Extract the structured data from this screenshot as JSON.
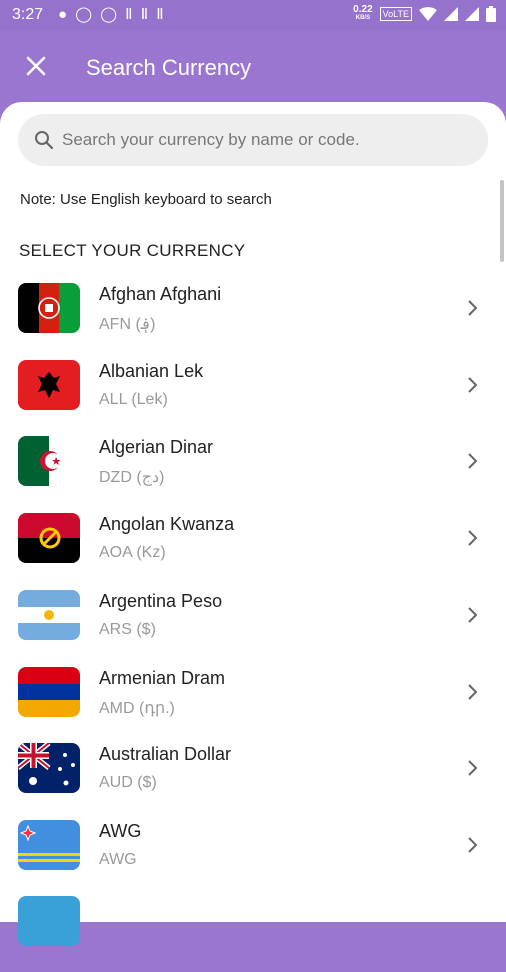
{
  "status_bar": {
    "time": "3:27",
    "speed_value": "0.22",
    "speed_unit": "KB/S",
    "network": "VoLTE"
  },
  "app_bar": {
    "title": "Search Currency"
  },
  "search": {
    "placeholder": "Search your currency by name or code."
  },
  "note": "Note: Use English keyboard to search",
  "section_title": "SELECT YOUR CURRENCY",
  "currencies": [
    {
      "name": "Afghan Afghani",
      "code": "AFN (؋)",
      "flag": "afghanistan-flag"
    },
    {
      "name": "Albanian Lek",
      "code": "ALL (Lek)",
      "flag": "albania-flag"
    },
    {
      "name": "Algerian Dinar",
      "code": "DZD (دج)",
      "flag": "algeria-flag"
    },
    {
      "name": "Angolan Kwanza",
      "code": "AOA (Kz)",
      "flag": "angola-flag"
    },
    {
      "name": "Argentina Peso",
      "code": "ARS ($)",
      "flag": "argentina-flag"
    },
    {
      "name": "Armenian Dram",
      "code": "AMD (դր.)",
      "flag": "armenia-flag"
    },
    {
      "name": "Australian Dollar",
      "code": "AUD ($)",
      "flag": "australia-flag"
    },
    {
      "name": "AWG",
      "code": "AWG",
      "flag": "aruba-flag"
    }
  ],
  "colors": {
    "accent": "#9b76d0",
    "search_bg": "#eeeeee"
  }
}
